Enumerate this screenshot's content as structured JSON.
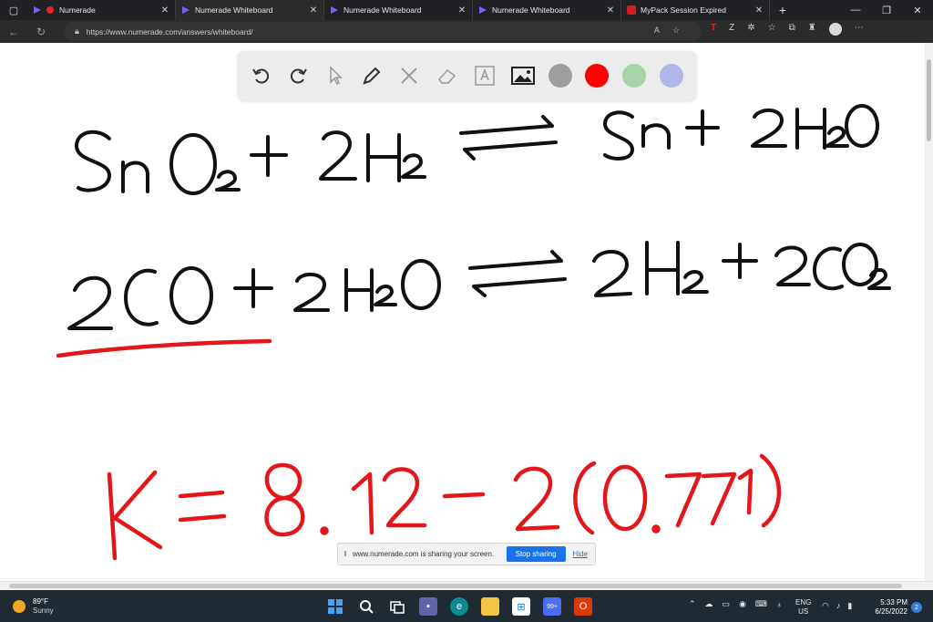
{
  "browser": {
    "tabs": [
      {
        "label": "Numerade",
        "active": false
      },
      {
        "label": "Numerade Whiteboard",
        "active": true
      },
      {
        "label": "Numerade Whiteboard",
        "active": false
      },
      {
        "label": "Numerade Whiteboard",
        "active": false
      },
      {
        "label": "MyPack Session Expired",
        "active": false
      }
    ],
    "url": "https://www.numerade.com/answers/whiteboard/"
  },
  "toolbar": {
    "tools": [
      "undo-icon",
      "redo-icon",
      "pointer-icon",
      "pen-icon",
      "tools-icon",
      "eraser-icon",
      "text-icon",
      "image-icon"
    ],
    "colors": [
      "#9e9e9e",
      "#ff0000",
      "#a8d5a8",
      "#b3b6ea"
    ],
    "selected_color": "#ff0000"
  },
  "whiteboard": {
    "equation_1": "SnO2 + 2H2 ⇌ Sn + 2H2O",
    "equation_2": "2CO + 2H2O ⇌ 2H2 + 2CO2",
    "equation_3": "K = 8.12 − 2(0.771)",
    "ink_colors": {
      "black": "#111111",
      "red": "#e3161b"
    }
  },
  "share_banner": {
    "message": "www.numerade.com is sharing your screen.",
    "stop_label": "Stop sharing",
    "hide_label": "Hide"
  },
  "taskbar": {
    "weather_temp": "89°F",
    "weather_condition": "Sunny",
    "language_1": "ENG",
    "language_2": "US",
    "time": "5:33 PM",
    "date": "6/25/2022",
    "notification_count": "2",
    "badge": "99+"
  }
}
